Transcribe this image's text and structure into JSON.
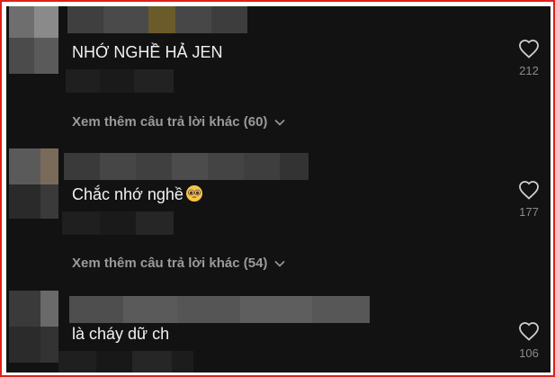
{
  "comments": [
    {
      "text": "NHỚ NGHỀ HẢ JEN",
      "likes": "212",
      "emoji": ""
    },
    {
      "text": "Chắc nhớ nghề",
      "likes": "177",
      "emoji": "pleading-face-emoji"
    },
    {
      "text": "là cháy dữ ch",
      "likes": "106",
      "emoji": ""
    }
  ],
  "replies": [
    {
      "label": "Xem thêm câu trả lời khác (60)"
    },
    {
      "label": "Xem thêm câu trả lời khác (54)"
    }
  ],
  "icons": {
    "like": "heart-outline-icon",
    "expand": "chevron-down-icon"
  },
  "colors": {
    "background": "#121212",
    "frame_border": "#e0201b",
    "text": "#f1f1f1",
    "muted": "#9a9a9a"
  }
}
